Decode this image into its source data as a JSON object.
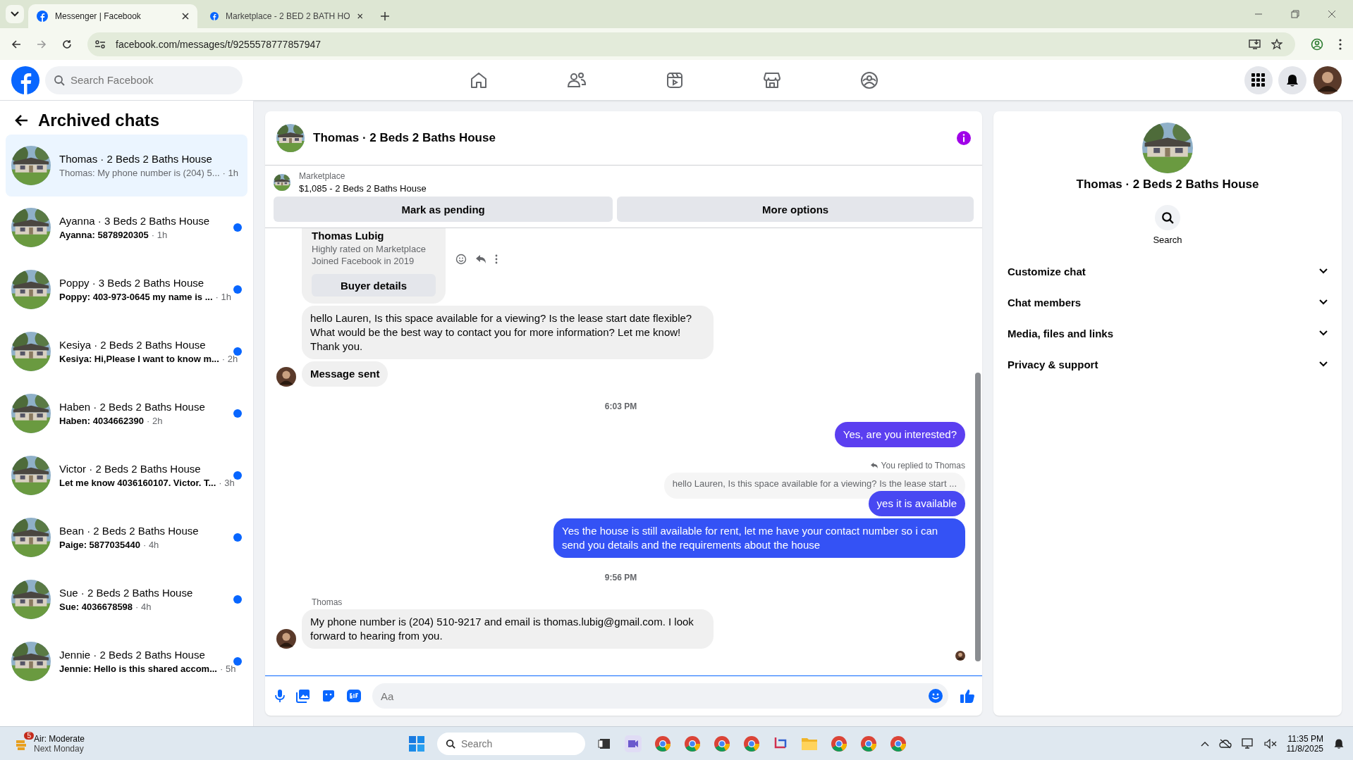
{
  "browser": {
    "tabs": [
      {
        "title": "Messenger | Facebook",
        "selected": true
      },
      {
        "title": "Marketplace - 2 BED 2 BATH HO",
        "selected": false
      }
    ],
    "url": "facebook.com/messages/t/9255578777857947"
  },
  "header": {
    "search_placeholder": "Search Facebook"
  },
  "sidebar": {
    "title": "Archived chats",
    "chats": [
      {
        "name": "Thomas · 2 Beds 2 Baths House",
        "preview": "Thomas: My phone number is (204) 5...",
        "time": "· 1h",
        "unread": false,
        "selected": true
      },
      {
        "name": "Ayanna · 3 Beds 2 Baths House",
        "preview": "Ayanna: 5878920305",
        "time": "· 1h",
        "unread": true,
        "selected": false
      },
      {
        "name": "Poppy · 3 Beds 2 Baths House",
        "preview": "Poppy: 403-973-0645 my name is ...",
        "time": "· 1h",
        "unread": true,
        "selected": false
      },
      {
        "name": "Kesiya · 2 Beds 2 Baths House",
        "preview": "Kesiya: Hi,Please I want to know m...",
        "time": "· 2h",
        "unread": true,
        "selected": false
      },
      {
        "name": "Haben · 2 Beds 2 Baths House",
        "preview": "Haben: 4034662390",
        "time": "· 2h",
        "unread": true,
        "selected": false
      },
      {
        "name": "Victor · 2 Beds 2 Baths House",
        "preview": "Let me know 4036160107. Victor. T...",
        "time": "· 3h",
        "unread": true,
        "selected": false
      },
      {
        "name": "Bean · 2 Beds 2 Baths House",
        "preview": "Paige: 5877035440",
        "time": "· 4h",
        "unread": true,
        "selected": false
      },
      {
        "name": "Sue · 2 Beds 2 Baths House",
        "preview": "Sue: 4036678598",
        "time": "· 4h",
        "unread": true,
        "selected": false
      },
      {
        "name": "Jennie · 2 Beds 2 Baths House",
        "preview": "Jennie: Hello is this shared accom...",
        "time": "· 5h",
        "unread": true,
        "selected": false
      }
    ]
  },
  "chat": {
    "title": "Thomas · 2 Beds 2 Baths House",
    "listing": {
      "label": "Marketplace",
      "title": "$1,085 - 2 Beds 2 Baths House"
    },
    "actions": [
      "Mark as pending",
      "More options"
    ],
    "messages": [
      {
        "kind": "buyer_card",
        "name": "Thomas Lubig",
        "lines": [
          "Highly rated on Marketplace",
          "Joined Facebook in 2019"
        ],
        "button": "Buyer details"
      },
      {
        "kind": "incoming",
        "text": "hello Lauren, Is this space available for a viewing? Is the lease start date flexible? What would be the best way to contact you for more information? Let me know! Thank you.",
        "avatar": false
      },
      {
        "kind": "status",
        "text": "Message sent",
        "avatar": true
      },
      {
        "kind": "time",
        "text": "6:03 PM"
      },
      {
        "kind": "outgoing",
        "text": "Yes, are you interested?",
        "color": "#5b3ff0"
      },
      {
        "kind": "reply_note",
        "text": "You replied to Thomas"
      },
      {
        "kind": "quote",
        "text": "hello Lauren, Is this space available for a viewing? Is the lease start ..."
      },
      {
        "kind": "outgoing",
        "text": "yes it is available",
        "color": "#4848f2"
      },
      {
        "kind": "outgoing",
        "text": "Yes the house is still available for rent, let me have your contact number so i can send you details and the requirements about the house",
        "color": "#3452f5"
      },
      {
        "kind": "time",
        "text": "9:56 PM"
      },
      {
        "kind": "sender",
        "text": "Thomas"
      },
      {
        "kind": "incoming",
        "text": "My phone number is (204) 510-9217 and email is thomas.lubig@gmail.com. I look forward to hearing from you.",
        "avatar": true
      }
    ],
    "composer_placeholder": "Aa"
  },
  "details": {
    "title": "Thomas · 2 Beds 2 Baths House",
    "search_label": "Search",
    "sections": [
      "Customize chat",
      "Chat members",
      "Media, files and links",
      "Privacy & support"
    ]
  },
  "taskbar": {
    "weather_badge": "5",
    "weather_title": "Air: Moderate",
    "weather_sub": "Next Monday",
    "search_placeholder": "Search",
    "time": "11:35 PM",
    "date": "11/8/2025"
  }
}
